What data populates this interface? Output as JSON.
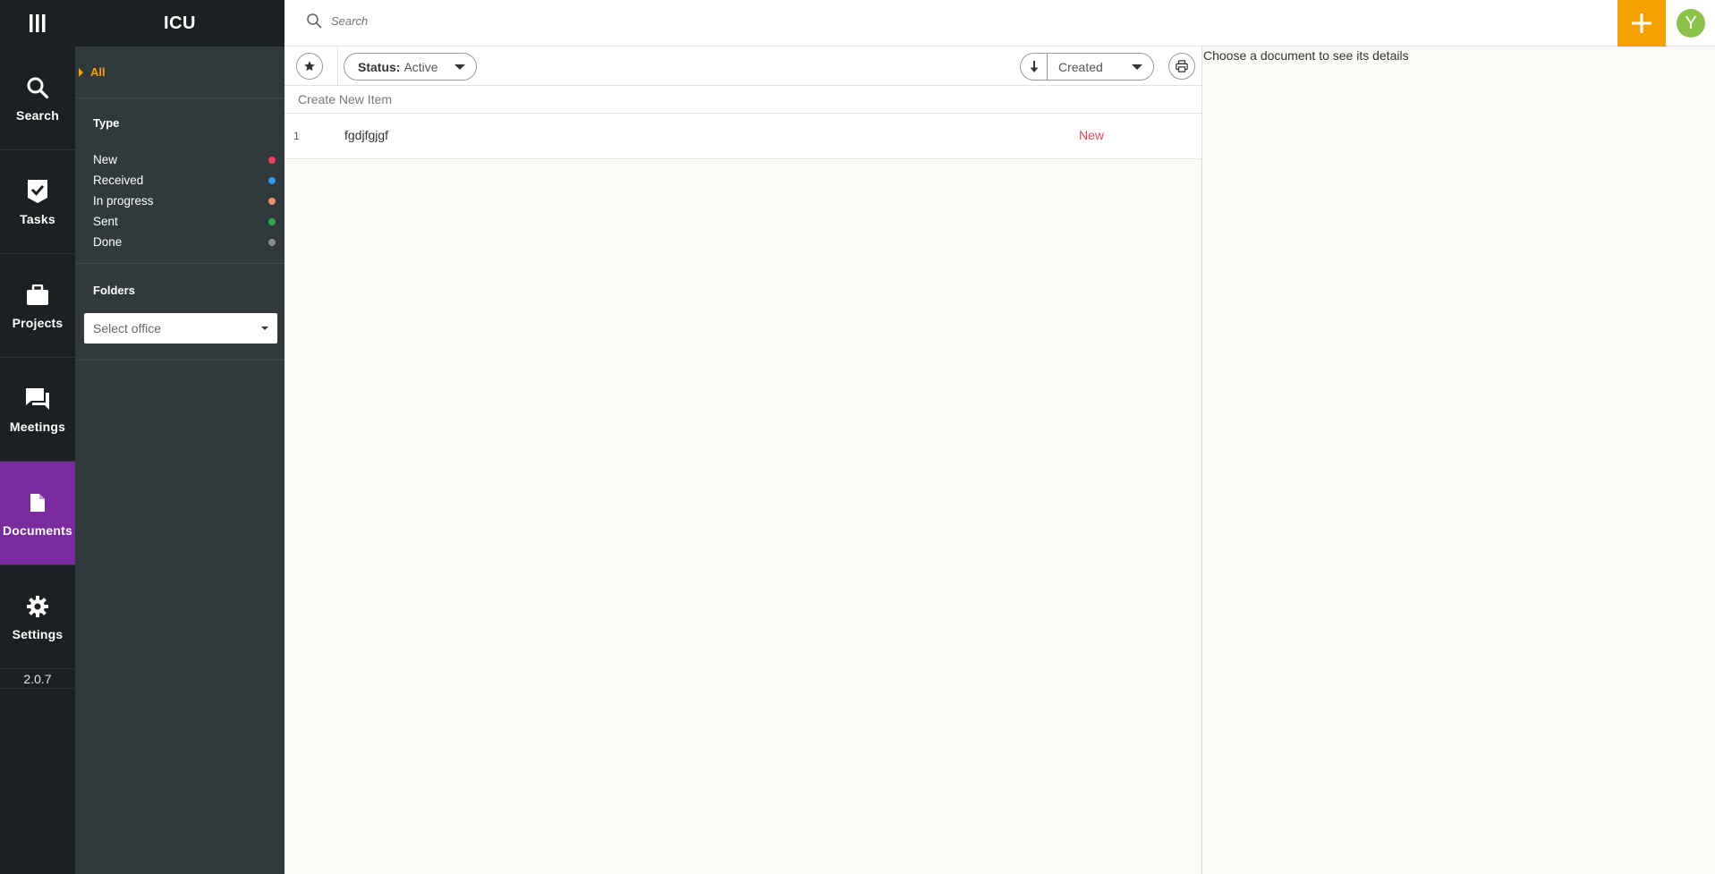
{
  "app": {
    "title": "ICU",
    "version": "2.0.7"
  },
  "rail": {
    "items": [
      {
        "label": "Search",
        "icon": "search-icon"
      },
      {
        "label": "Tasks",
        "icon": "task-check-icon"
      },
      {
        "label": "Projects",
        "icon": "briefcase-icon"
      },
      {
        "label": "Meetings",
        "icon": "chat-icon"
      },
      {
        "label": "Documents",
        "icon": "document-icon",
        "active": true
      },
      {
        "label": "Settings",
        "icon": "gear-icon"
      }
    ]
  },
  "filters": {
    "all_label": "All",
    "type_title": "Type",
    "types": [
      {
        "label": "New",
        "color": "#f0415c"
      },
      {
        "label": "Received",
        "color": "#2f9be0"
      },
      {
        "label": "In progress",
        "color": "#f58c6b"
      },
      {
        "label": "Sent",
        "color": "#2fa84f"
      },
      {
        "label": "Done",
        "color": "#8a8a8a"
      }
    ],
    "folders_title": "Folders",
    "office_placeholder": "Select office"
  },
  "search": {
    "placeholder": "Search"
  },
  "user": {
    "initial": "Y"
  },
  "toolbar": {
    "status_label": "Status:",
    "status_value": "Active",
    "sort_field": "Created"
  },
  "list": {
    "create_label": "Create New Item",
    "items": [
      {
        "number": "1",
        "title": "fgdjfgjgf",
        "status": "New"
      }
    ]
  },
  "details": {
    "empty_hint": "Choose a document to see its details"
  },
  "colors": {
    "accent": "#f6a000",
    "active_nav": "#7a2c9e",
    "status_new": "#f0415c"
  }
}
